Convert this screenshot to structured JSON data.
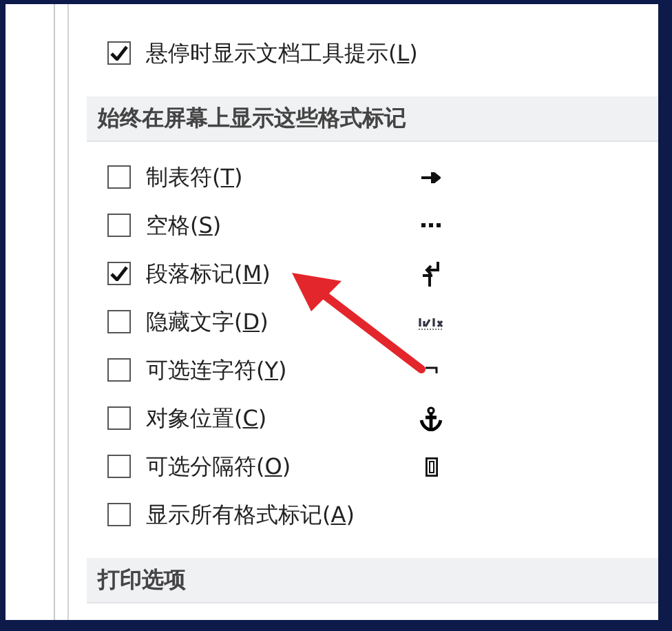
{
  "top_option": {
    "label": "悬停时显示文档工具提示(L)",
    "checked": true
  },
  "sections": [
    {
      "title": "始终在屏幕上显示这些格式标记",
      "options": [
        {
          "label": "制表符(T)",
          "checked": false,
          "kind": "tab"
        },
        {
          "label": "空格(S)",
          "checked": false,
          "kind": "space"
        },
        {
          "label": "段落标记(M)",
          "checked": true,
          "kind": "paragraph"
        },
        {
          "label": "隐藏文字(D)",
          "checked": false,
          "kind": "hidden"
        },
        {
          "label": "可选连字符(Y)",
          "checked": false,
          "kind": "hyphen"
        },
        {
          "label": "对象位置(C)",
          "checked": false,
          "kind": "anchor"
        },
        {
          "label": "可选分隔符(O)",
          "checked": false,
          "kind": "break"
        },
        {
          "label": "显示所有格式标记(A)",
          "checked": false
        }
      ]
    },
    {
      "title": "打印选项"
    }
  ]
}
